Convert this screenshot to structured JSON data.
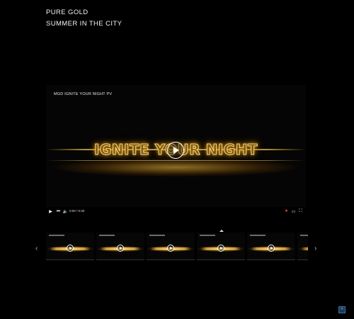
{
  "headline": {
    "line1": "PURE GOLD",
    "line2": "SUMMER IN THE CITY"
  },
  "player": {
    "video_title": "MGD IGNITE YOUR NIGHT PV",
    "big_text": "IGNITE YOUR NIGHT",
    "time": "0:00 / 0:30",
    "progress": 0.0,
    "accent_color": "#ffc23c"
  },
  "carousel": {
    "thumbnail_count": 6,
    "selected_index": 3
  },
  "icons": {
    "play": "play-icon",
    "next": "next-icon",
    "volume": "volume-icon",
    "captions": "captions-icon",
    "settings": "settings-icon",
    "fullscreen": "fullscreen-icon",
    "prev_arrow": "chevron-left-icon",
    "next_arrow": "chevron-right-icon",
    "scroll_top": "arrow-up-icon"
  }
}
